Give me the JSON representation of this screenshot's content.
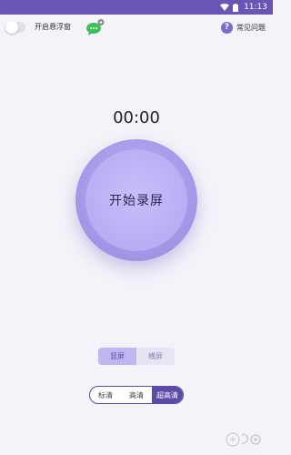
{
  "status_bar": {
    "time": "11:13"
  },
  "toolbar": {
    "float_window_label": "开启悬浮窗",
    "float_window_enabled": false,
    "help_label": "常见问题",
    "help_icon_glyph": "?"
  },
  "timer": "00:00",
  "record_button": {
    "label": "开始录屏"
  },
  "orientation": {
    "options": [
      "竖屏",
      "横屏"
    ],
    "selected": "竖屏"
  },
  "quality": {
    "options": [
      "标清",
      "高清",
      "超高清"
    ],
    "selected": "超高清"
  },
  "colors": {
    "status_bar": "#6a55b4",
    "accent": "#5c4aa6",
    "record_button": "#a89ae9",
    "background": "#f4f3f9"
  },
  "icons": [
    "wifi-icon",
    "battery-icon",
    "chat-bubble-icon",
    "help-icon"
  ]
}
